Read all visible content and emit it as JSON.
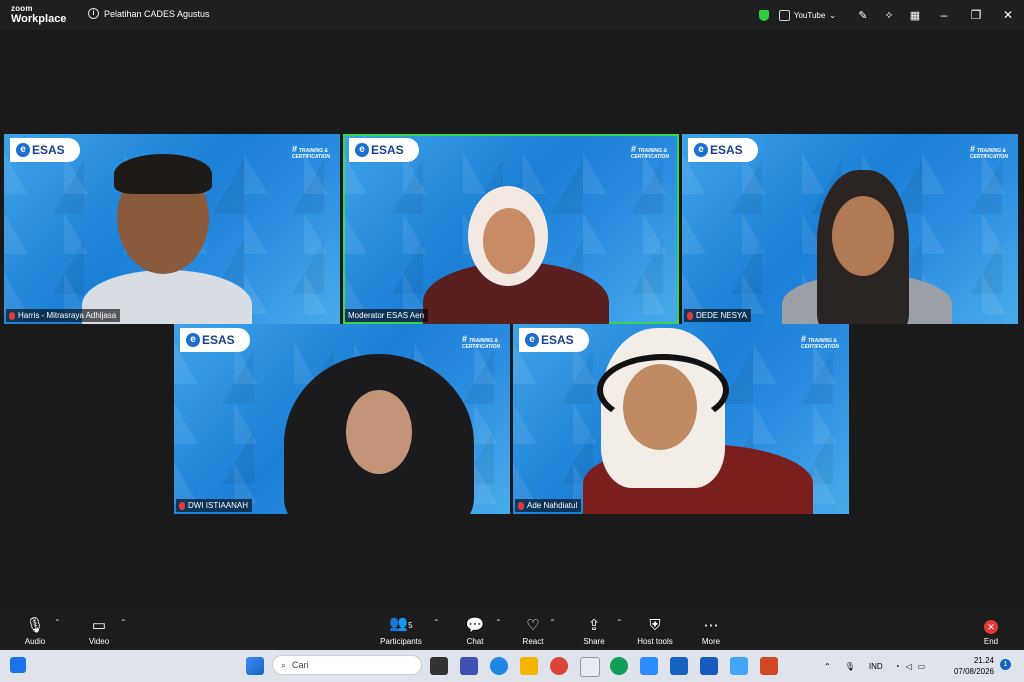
{
  "titlebar": {
    "brand_top": "zoom",
    "brand_bottom": "Workplace",
    "meeting_title": "Pelatihan CADES Agustus",
    "youtube_label": "YouTube"
  },
  "tile_brand": {
    "logo_text": "ESAS",
    "tc_line1": "TRAINING &",
    "tc_line2": "CERTIFICATION"
  },
  "participants": [
    {
      "name": "Harris - Mitrasraya Adhijasa"
    },
    {
      "name": "Moderator ESAS Aen"
    },
    {
      "name": "DEDE NESYA"
    },
    {
      "name": "DWI ISTIAANAH"
    },
    {
      "name": "Ade Nahdiatul"
    }
  ],
  "toolbar": {
    "audio": "Audio",
    "video": "Video",
    "participants": "Participants",
    "participants_count": "5",
    "chat": "Chat",
    "react": "React",
    "share": "Share",
    "host_tools": "Host tools",
    "more": "More",
    "end": "End"
  },
  "taskbar": {
    "search_placeholder": "Cari",
    "language": "IND",
    "time": "21.24",
    "date": "07/08/2026",
    "notification_count": "1"
  },
  "colors": {
    "active_speaker": "#39d353",
    "end_red": "#e03a3a",
    "tile_blue": "#1b7fd6"
  }
}
